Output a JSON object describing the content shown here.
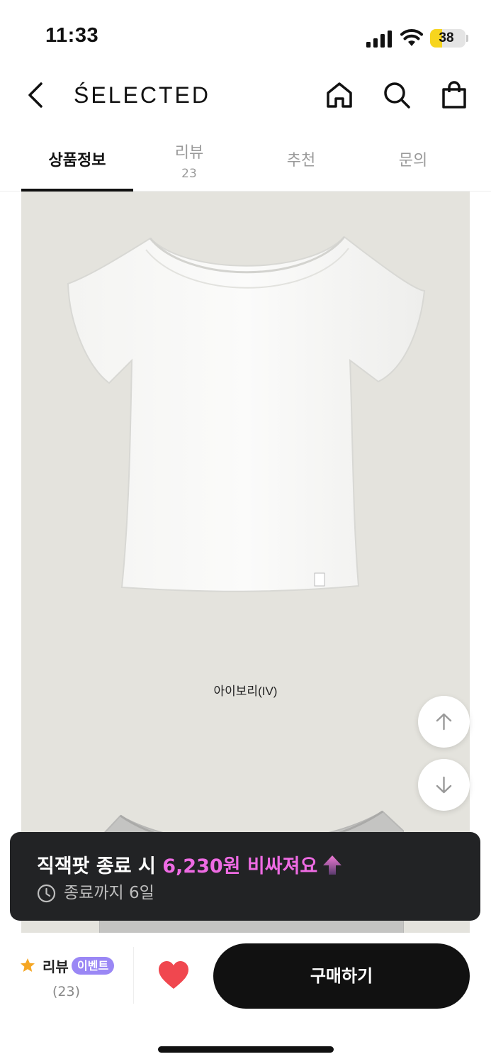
{
  "status_bar": {
    "time": "11:33",
    "battery": "38",
    "battery_level_percent": 38
  },
  "header": {
    "brand": "ŚELECTED",
    "icons": {
      "back": "chevron-left-icon",
      "home": "home-icon",
      "search": "search-icon",
      "cart": "shopping-bag-icon"
    }
  },
  "tabs": [
    {
      "label": "상품정보",
      "active": true
    },
    {
      "label": "리뷰",
      "count": "23",
      "active": false
    },
    {
      "label": "추천",
      "active": false
    },
    {
      "label": "문의",
      "active": false
    }
  ],
  "product": {
    "color_label": "아이보리(IV)"
  },
  "promo": {
    "text_before": "직잭팟 종료 시 ",
    "price_text": "6,230원 비싸져요",
    "deadline": "종료까지 6일",
    "price_color": "#ee6be3"
  },
  "bottom_bar": {
    "review_label": "리뷰",
    "event_badge": "이벤트",
    "review_count": "(23)",
    "buy_label": "구매하기"
  },
  "colors": {
    "accent_event": "#9a87f5",
    "heart": "#f0474f",
    "star": "#f5a623",
    "toast_bg": "#222325"
  }
}
